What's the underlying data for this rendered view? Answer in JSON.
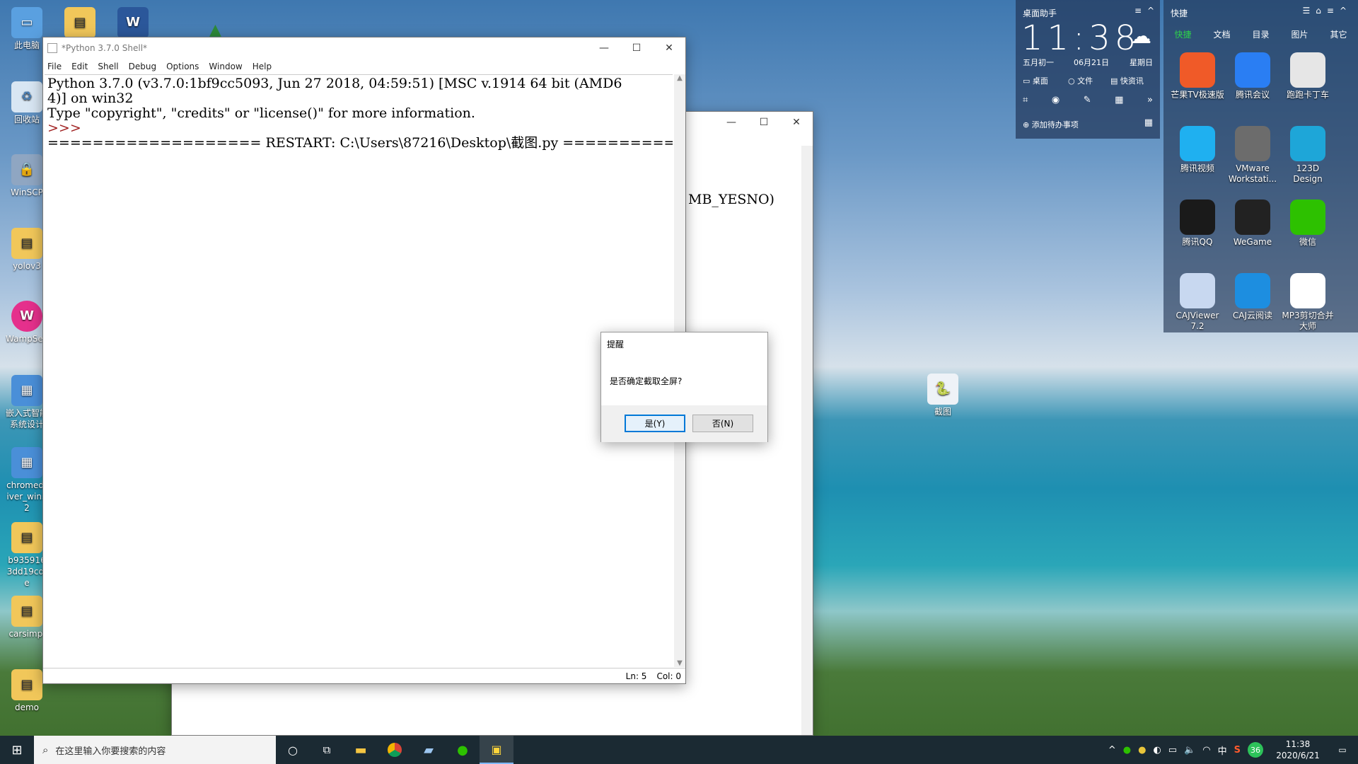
{
  "desktop_icons": [
    {
      "label": "此电脑",
      "icon": "computer-icon"
    },
    {
      "label": "回收站",
      "icon": "recycle-bin-icon"
    },
    {
      "label": "WinSCP",
      "icon": "winscp-icon"
    },
    {
      "label": "yolov3",
      "icon": "folder-icon"
    },
    {
      "label": "WampServer",
      "icon": "wamp-icon"
    },
    {
      "label": "嵌入式智能系统设计",
      "icon": "archive-icon"
    },
    {
      "label": "chromedriver_win32",
      "icon": "archive-icon"
    },
    {
      "label": "b9359163dd19cdfe",
      "icon": "folder-icon"
    },
    {
      "label": "carsimpl",
      "icon": "folder-icon"
    },
    {
      "label": "demo",
      "icon": "folder-icon"
    },
    {
      "label": "截图",
      "icon": "python-file-icon"
    }
  ],
  "shell": {
    "title": "*Python 3.7.0 Shell*",
    "menu": [
      "File",
      "Edit",
      "Shell",
      "Debug",
      "Options",
      "Window",
      "Help"
    ],
    "lines": [
      "Python 3.7.0 (v3.7.0:1bf9cc5093, Jun 27 2018, 04:59:51) [MSC v.1914 64 bit (AMD6",
      "4)] on win32",
      "Type \"copyright\", \"credits\" or \"license()\" for more information.",
      ">>>",
      "=================== RESTART: C:\\Users\\87216\\Desktop\\截图.py ==================="
    ],
    "status": {
      "ln": "Ln: 5",
      "col": "Col: 0"
    }
  },
  "back_window": {
    "visible_text": "MB_YESNO)"
  },
  "dialog": {
    "title": "提醒",
    "message": "是否确定截取全屏?",
    "yes": "是(Y)",
    "no": "否(N)"
  },
  "assistant": {
    "title": "桌面助手",
    "time": "11:38",
    "lunar": "五月初一",
    "date": "06月21日",
    "weekday": "星期日",
    "links": [
      "桌面",
      "文件",
      "快资讯"
    ],
    "todo": "添加待办事项"
  },
  "quick": {
    "title": "快捷",
    "tabs": [
      "快捷",
      "文档",
      "目录",
      "图片",
      "其它"
    ],
    "apps": [
      {
        "label": "芒果TV极速版",
        "color": "#f05a28"
      },
      {
        "label": "腾讯会议",
        "color": "#2a7ef3"
      },
      {
        "label": "跑跑卡丁车",
        "color": "#e6e6e6"
      },
      {
        "label": "腾讯视频",
        "color": "#1fb0f0"
      },
      {
        "label": "VMware Workstati...",
        "color": "#6c6c6c"
      },
      {
        "label": "123D Design",
        "color": "#1ea6d8"
      },
      {
        "label": "腾讯QQ",
        "color": "#1a1a1a"
      },
      {
        "label": "WeGame",
        "color": "#222222"
      },
      {
        "label": "微信",
        "color": "#2dc100"
      },
      {
        "label": "CAJViewer 7.2",
        "color": "#c8d8f0"
      },
      {
        "label": "CAJ云阅读",
        "color": "#1d8ee0"
      },
      {
        "label": "MP3剪切合并大师",
        "color": "#ffffff"
      }
    ]
  },
  "taskbar": {
    "search_placeholder": "在这里输入你要搜索的内容",
    "clock_time": "11:38",
    "clock_date": "2020/6/21",
    "ime": "中",
    "badge": "36"
  }
}
